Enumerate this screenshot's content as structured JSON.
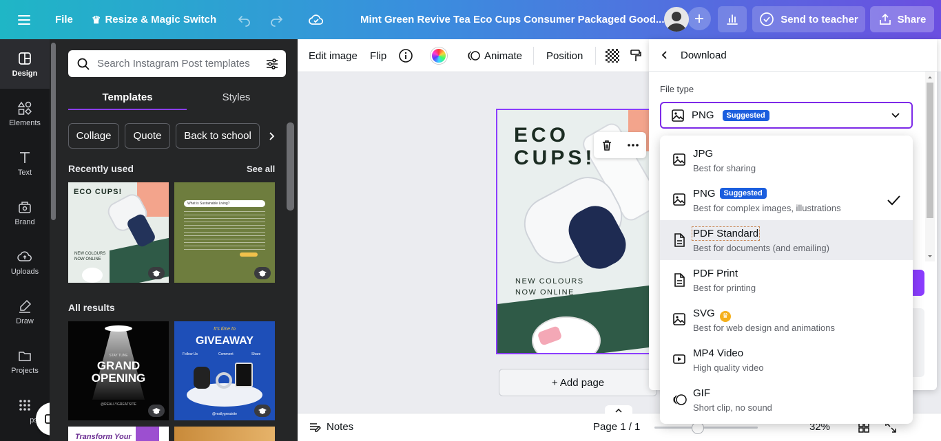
{
  "topbar": {
    "file": "File",
    "resize": "Resize & Magic Switch",
    "title": "Mint Green Revive Tea Eco Cups Consumer Packaged Good...",
    "send": "Send to teacher",
    "share": "Share"
  },
  "rail": [
    {
      "label": "Design",
      "icon": "design-icon"
    },
    {
      "label": "Elements",
      "icon": "elements-icon"
    },
    {
      "label": "Text",
      "icon": "text-icon"
    },
    {
      "label": "Brand",
      "icon": "brand-icon"
    },
    {
      "label": "Uploads",
      "icon": "uploads-icon"
    },
    {
      "label": "Draw",
      "icon": "draw-icon"
    },
    {
      "label": "Projects",
      "icon": "projects-icon"
    },
    {
      "label": "ps",
      "icon": "apps-icon"
    }
  ],
  "panel": {
    "search_placeholder": "Search Instagram Post templates",
    "tabs": [
      "Templates",
      "Styles"
    ],
    "chips": [
      "Collage",
      "Quote",
      "Back to school"
    ],
    "recently_used": "Recently used",
    "see_all": "See all",
    "all_results": "All results",
    "thumbs": {
      "eco_title": "ECO CUPS!",
      "eco_sub1": "NEW COLOURS",
      "eco_sub2": "NOW ONLINE",
      "sustain_title": "What is Sustainable Living?",
      "grand_small": "STAY TUNE",
      "grand_l1": "GRAND",
      "grand_l2": "OPENING",
      "grand_handle": "@REALLYGREATSITE",
      "give_small": "It's time to",
      "give_title": "GIVEAWAY",
      "give_l1": "Follow Us",
      "give_l2": "Comment",
      "give_l3": "Share",
      "give_handle": "@reallygreatsite",
      "transform": "Transform Your"
    }
  },
  "ctx": {
    "edit_image": "Edit image",
    "flip": "Flip",
    "animate": "Animate",
    "position": "Position"
  },
  "design": {
    "title_l1": "ECO",
    "title_l2": "CUPS!",
    "sub_l1": "NEW COLOURS",
    "sub_l2": "NOW ONLINE"
  },
  "add_page": "+ Add page",
  "bottom": {
    "notes": "Notes",
    "page": "Page 1 / 1",
    "zoom": "32%"
  },
  "download": {
    "back_label": "Download",
    "file_type_label": "File type",
    "selected": "PNG",
    "suggested": "Suggested",
    "options": [
      {
        "name": "JPG",
        "desc": "Best for sharing",
        "icon": "image-icon"
      },
      {
        "name": "PNG",
        "desc": "Best for complex images, illustrations",
        "icon": "image-icon",
        "badge": "Suggested",
        "checked": true
      },
      {
        "name": "PDF Standard",
        "desc": "Best for documents (and emailing)",
        "icon": "document-icon"
      },
      {
        "name": "PDF Print",
        "desc": "Best for printing",
        "icon": "document-icon"
      },
      {
        "name": "SVG",
        "desc": "Best for web design and animations",
        "icon": "image-icon",
        "pro": true
      },
      {
        "name": "MP4 Video",
        "desc": "High quality video",
        "icon": "video-icon"
      },
      {
        "name": "GIF",
        "desc": "Short clip, no sound",
        "icon": "gif-icon"
      }
    ]
  },
  "colors": {
    "accent": "#7d2ae8",
    "suggested_badge": "#1b5ede",
    "rail_bg": "#18191b",
    "panel_bg": "#252627"
  }
}
